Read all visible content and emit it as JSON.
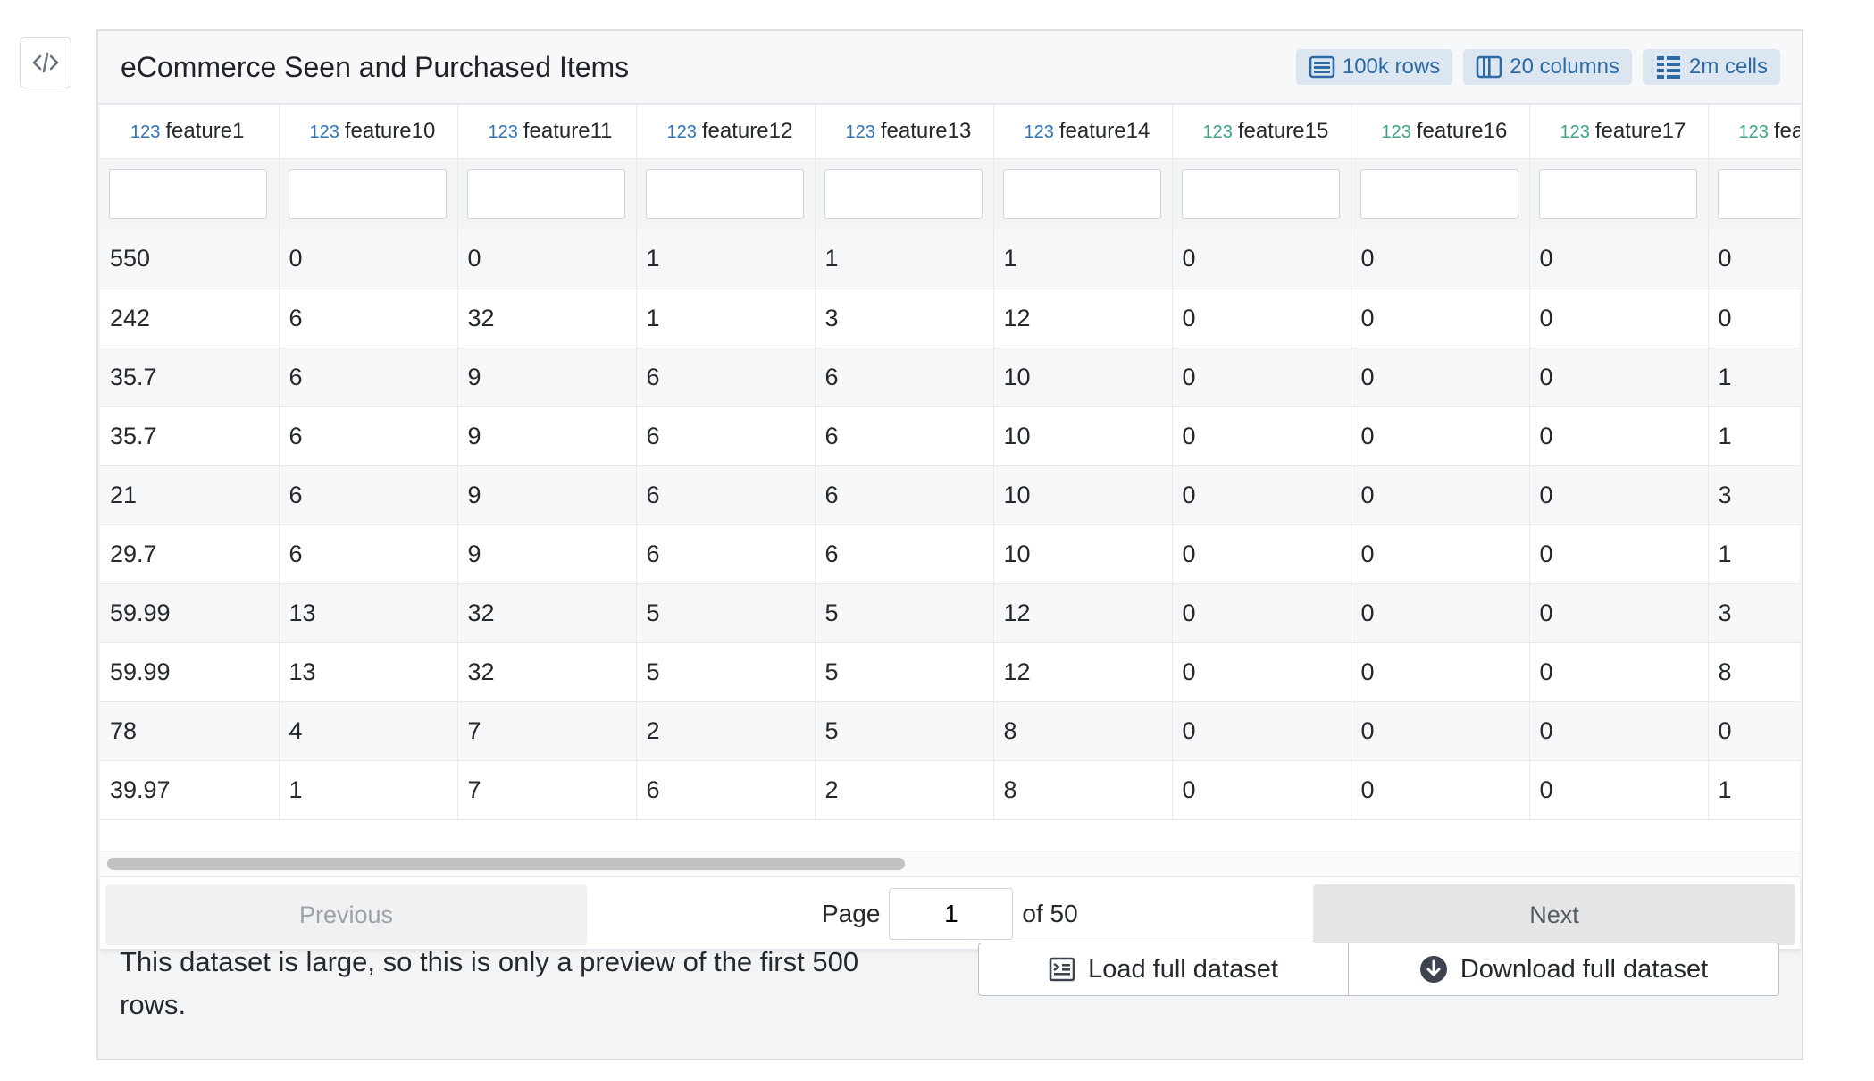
{
  "title": "eCommerce Seen and Purchased Items",
  "badges": {
    "rows": "100k rows",
    "columns": "20 columns",
    "cells": "2m cells"
  },
  "columns": [
    {
      "type": "123",
      "name": "feature1"
    },
    {
      "type": "123",
      "name": "feature10"
    },
    {
      "type": "123",
      "name": "feature11"
    },
    {
      "type": "123",
      "name": "feature12"
    },
    {
      "type": "123",
      "name": "feature13"
    },
    {
      "type": "123",
      "name": "feature14"
    },
    {
      "type": "123",
      "name": "feature15"
    },
    {
      "type": "123",
      "name": "feature16"
    },
    {
      "type": "123",
      "name": "feature17"
    },
    {
      "type": "123",
      "name": "fea"
    }
  ],
  "rows": [
    [
      "550",
      "0",
      "0",
      "1",
      "1",
      "1",
      "0",
      "0",
      "0",
      "0"
    ],
    [
      "242",
      "6",
      "32",
      "1",
      "3",
      "12",
      "0",
      "0",
      "0",
      "0"
    ],
    [
      "35.7",
      "6",
      "9",
      "6",
      "6",
      "10",
      "0",
      "0",
      "0",
      "1"
    ],
    [
      "35.7",
      "6",
      "9",
      "6",
      "6",
      "10",
      "0",
      "0",
      "0",
      "1"
    ],
    [
      "21",
      "6",
      "9",
      "6",
      "6",
      "10",
      "0",
      "0",
      "0",
      "3"
    ],
    [
      "29.7",
      "6",
      "9",
      "6",
      "6",
      "10",
      "0",
      "0",
      "0",
      "1"
    ],
    [
      "59.99",
      "13",
      "32",
      "5",
      "5",
      "12",
      "0",
      "0",
      "0",
      "3"
    ],
    [
      "59.99",
      "13",
      "32",
      "5",
      "5",
      "12",
      "0",
      "0",
      "0",
      "8"
    ],
    [
      "78",
      "4",
      "7",
      "2",
      "5",
      "8",
      "0",
      "0",
      "0",
      "0"
    ],
    [
      "39.97",
      "1",
      "7",
      "6",
      "2",
      "8",
      "0",
      "0",
      "0",
      "1"
    ]
  ],
  "pagination": {
    "previous_label": "Previous",
    "page_label": "Page",
    "current_page": "1",
    "of_label": "of 50",
    "next_label": "Next"
  },
  "notice": "This dataset is large, so this is only a preview of the first 500 rows.",
  "actions": {
    "load_label": "Load full dataset",
    "download_label": "Download full dataset"
  },
  "colors": {
    "badge_bg": "#dbe6f1",
    "badge_text": "#2d6aa3",
    "type_tag_blue": "#2d73b5",
    "type_tag_green": "#3aa38a"
  },
  "icons": {
    "code_toggle": "code-icon",
    "rows_badge": "rows-icon",
    "columns_badge": "columns-icon",
    "cells_badge": "cells-icon",
    "load_action": "load-dataset-icon",
    "download_action": "download-icon"
  }
}
